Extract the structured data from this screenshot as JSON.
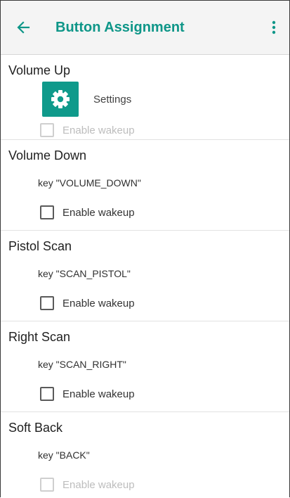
{
  "appbar": {
    "title": "Button Assignment",
    "back_icon": "arrow-left-icon",
    "menu_icon": "more-vert-icon",
    "accent": "#0e9688"
  },
  "sections": [
    {
      "title": "Volume Up",
      "app_label": "Settings",
      "app_icon": "gear-icon",
      "wakeup_label": "Enable wakeup",
      "wakeup_enabled": false
    },
    {
      "title": "Volume Down",
      "key": "key \"VOLUME_DOWN\"",
      "wakeup_label": "Enable wakeup",
      "wakeup_enabled": true
    },
    {
      "title": "Pistol Scan",
      "key": "key \"SCAN_PISTOL\"",
      "wakeup_label": "Enable wakeup",
      "wakeup_enabled": true
    },
    {
      "title": "Right Scan",
      "key": "key \"SCAN_RIGHT\"",
      "wakeup_label": "Enable wakeup",
      "wakeup_enabled": true
    },
    {
      "title": "Soft Back",
      "key": "key \"BACK\"",
      "wakeup_label": "Enable wakeup",
      "wakeup_enabled": false
    }
  ]
}
